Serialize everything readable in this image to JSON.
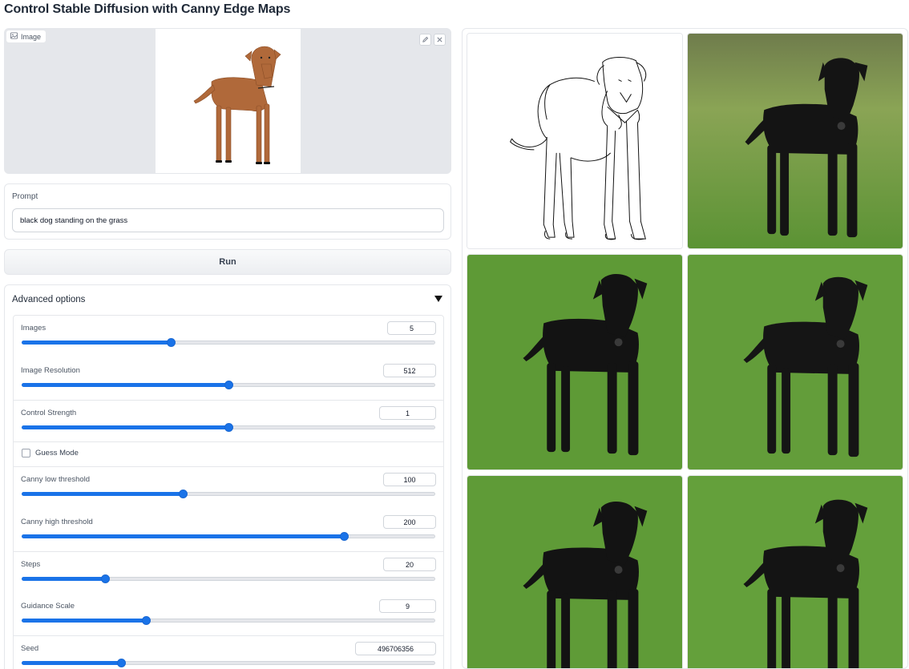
{
  "app": {
    "title": "Control Stable Diffusion with Canny Edge Maps"
  },
  "image_input": {
    "label": "Image",
    "icons": [
      "image-icon",
      "edit-icon",
      "close-icon"
    ]
  },
  "prompt": {
    "label": "Prompt",
    "value": "black dog standing on the grass"
  },
  "run_button": {
    "label": "Run"
  },
  "advanced": {
    "title": "Advanced options",
    "expanded": true,
    "sliders": [
      {
        "label": "Images",
        "value": "5",
        "fraction": 0.36
      },
      {
        "label": "Image Resolution",
        "value": "512",
        "fraction": 0.5
      },
      {
        "label": "Control Strength",
        "value": "1",
        "fraction": 0.5
      },
      {
        "label": "Canny low threshold",
        "value": "100",
        "fraction": 0.39
      },
      {
        "label": "Canny high threshold",
        "value": "200",
        "fraction": 0.78
      },
      {
        "label": "Steps",
        "value": "20",
        "fraction": 0.2
      },
      {
        "label": "Guidance Scale",
        "value": "9",
        "fraction": 0.3
      },
      {
        "label": "Seed",
        "value": "496706356",
        "fraction": 0.24
      }
    ],
    "guess_mode": {
      "label": "Guess Mode",
      "checked": false
    }
  },
  "gallery": {
    "items": [
      {
        "kind": "canny-edge-map"
      },
      {
        "kind": "generated-image"
      },
      {
        "kind": "generated-image"
      },
      {
        "kind": "generated-image"
      },
      {
        "kind": "generated-image"
      },
      {
        "kind": "generated-image"
      }
    ]
  },
  "colors": {
    "accent": "#1a73e8",
    "grass": "#5f9a3a",
    "dog_black": "#141414",
    "dog_brown": "#b0693a"
  }
}
